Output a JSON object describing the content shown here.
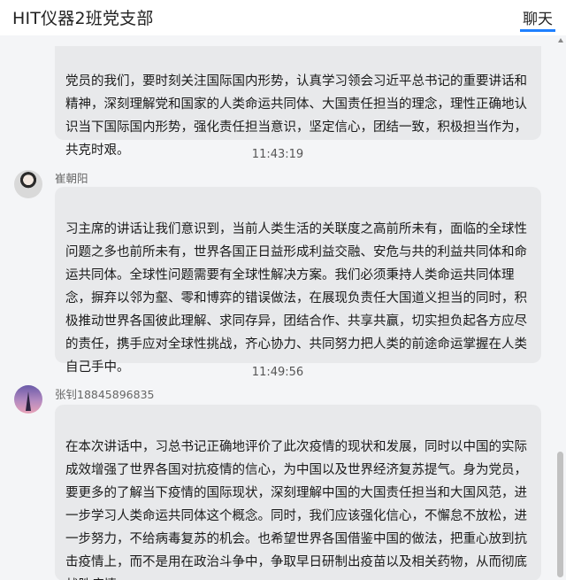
{
  "header": {
    "chat_title": "HIT仪器2班党支部",
    "tab_label": "聊天"
  },
  "messages": [
    {
      "text": "党员的我们，要时刻关注国际国内形势，认真学习领会习近平总书记的重要讲话和\n精神，深刻理解党和国家的人类命运共同体、大国责任担当的理念，理性正确地认\n识当下国际国内形势，强化责任担当意识，坚定信心，团结一致，积极担当作为，\n共克时艰。"
    },
    {
      "timestamp": "11:43:19",
      "sender": "崔朝阳",
      "text": "习主席的讲话让我们意识到，当前人类生活的关联度之高前所未有，面临的全球性\n问题之多也前所未有，世界各国正日益形成利益交融、安危与共的利益共同体和命\n运共同体。全球性问题需要有全球性解决方案。我们必须秉持人类命运共同体理\n念，摒弃以邻为壑、零和博弈的错误做法，在展现负责任大国道义担当的同时，积\n极推动世界各国彼此理解、求同存异，团结合作、共享共赢，切实担负起各方应尽\n的责任，携手应对全球性挑战，齐心协力、共同努力把人类的前途命运掌握在人类\n自己手中。"
    },
    {
      "timestamp": "11:49:56",
      "sender": "张钊18845896835",
      "text": "在本次讲话中，习总书记正确地评价了此次疫情的现状和发展，同时以中国的实际\n成效增强了世界各国对抗疫情的信心，为中国以及世界经济复苏提气。身为党员，\n要更多的了解当下疫情的国际现状，深刻理解中国的大国责任担当和大国风范，进\n一步学习人类命运共同体这个概念。同时，我们应该强化信心，不懈怠不放松，进\n一步努力，不给病毒复苏的机会。也希望世界各国借鉴中国的做法，把重心放到抗\n击疫情上，而不是用在政治斗争中，争取早日研制出疫苗以及相关药物，从而彻底\n战胜疫情"
    }
  ]
}
